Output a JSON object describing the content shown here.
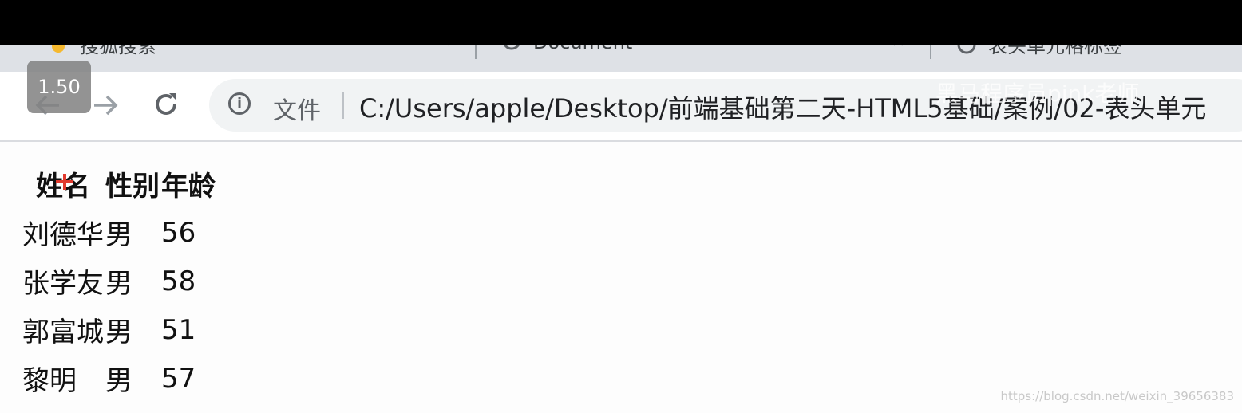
{
  "player": {
    "speed": "1.50"
  },
  "tabs": [
    {
      "title": "搜狐搜索",
      "icon": "paw-icon"
    },
    {
      "title": "Document",
      "icon": "globe-icon"
    },
    {
      "title": "表头单元格标签",
      "icon": "globe-icon"
    }
  ],
  "toolbar": {
    "file_label": "文件",
    "url": "C:/Users/apple/Desktop/前端基础第二天-HTML5基础/案例/02-表头单元"
  },
  "watermark": "黑马程序员pink老师",
  "table": {
    "headers": [
      "姓名",
      "性别",
      "年龄"
    ],
    "rows": [
      [
        "刘德华",
        "男",
        "56"
      ],
      [
        "张学友",
        "男",
        "58"
      ],
      [
        "郭富城",
        "男",
        "51"
      ],
      [
        "黎明",
        "男",
        "57"
      ]
    ]
  },
  "credit": "https://blog.csdn.net/weixin_39656383"
}
